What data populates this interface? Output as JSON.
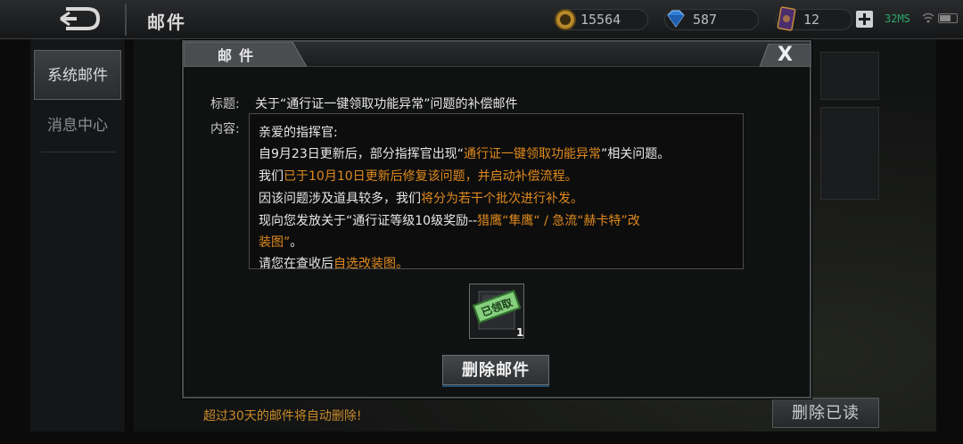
{
  "header": {
    "page_title": "邮件",
    "coins": "15564",
    "diamonds": "587",
    "cards": "12",
    "ping": "32MS"
  },
  "sidebar": {
    "items": [
      {
        "label": "系统邮件"
      },
      {
        "label": "消息中心"
      }
    ]
  },
  "background": {
    "auto_delete_notice": "超过30天的邮件将自动删除!",
    "delete_read_label": "删除已读"
  },
  "modal": {
    "title": "邮件",
    "close_label": "X",
    "subject_label": "标题:",
    "subject": "关于“通行证一键领取功能异常”问题的补偿邮件",
    "content_label": "内容:",
    "content": {
      "greeting": "亲爱的指挥官:",
      "l2a": "自9月23日更新后，部分指挥官出现“",
      "l2b": "通行证一键领取功能异常",
      "l2c": "”相关问题。",
      "l3a": "我们",
      "l3b": "已于10月10日更新后修复该问题，并启动补偿流程。",
      "l4a": "因该问题涉及道具较多，我们",
      "l4b": "将分为若干个批次进行补发。",
      "l5a": "现向您发放关于“通行证等级10级奖励--",
      "l5b": "猎鹰“隼鹰“ / 急流“赫卡特”改",
      "l6": "装图”",
      "l6b": "。",
      "l7a": "请您在查收后",
      "l7b": "自选改装图。"
    },
    "attachment": {
      "stamp": "已领取",
      "count": "1"
    },
    "delete_label": "删除邮件"
  },
  "colors": {
    "highlight": "#e08a1e",
    "notice": "#c88a2a",
    "ping": "#2aa96b"
  }
}
